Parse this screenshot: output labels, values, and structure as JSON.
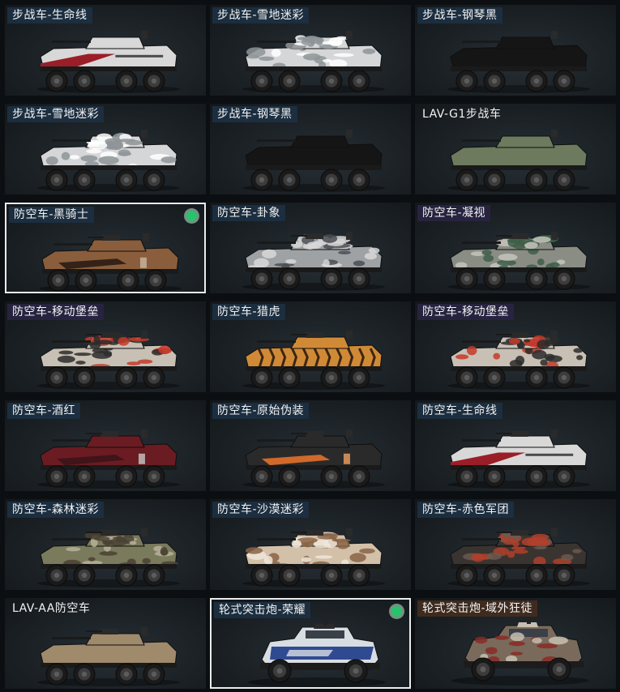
{
  "skins": [
    {
      "label": "步战车-生命线",
      "tag": "blue",
      "vehicle": "ifv",
      "pattern": "lifeline",
      "equipped": false,
      "colors": {
        "base": "#d8d8d8",
        "accent": "#9a1e28",
        "dark": "#4a4a4a"
      }
    },
    {
      "label": "步战车-雪地迷彩",
      "tag": "blue",
      "vehicle": "ifv",
      "pattern": "camo",
      "equipped": false,
      "colors": {
        "base": "#d4d6d8",
        "accent": "#8e9498",
        "dark": "#ffffff"
      }
    },
    {
      "label": "步战车-钢琴黑",
      "tag": "blue",
      "vehicle": "ifv",
      "pattern": "solid",
      "equipped": false,
      "colors": {
        "base": "#151515",
        "accent": "#2a2a2a",
        "dark": "#b8a060"
      }
    },
    {
      "label": "步战车-雪地迷彩",
      "tag": "blue",
      "vehicle": "ifv",
      "pattern": "camo",
      "equipped": false,
      "colors": {
        "base": "#d4d6d8",
        "accent": "#8e9498",
        "dark": "#ffffff"
      }
    },
    {
      "label": "步战车-钢琴黑",
      "tag": "blue",
      "vehicle": "ifv",
      "pattern": "solid",
      "equipped": false,
      "colors": {
        "base": "#151515",
        "accent": "#2a2a2a",
        "dark": "#b8a060"
      }
    },
    {
      "label": "LAV-G1步战车",
      "tag": "plain",
      "vehicle": "ifv",
      "pattern": "solid",
      "equipped": false,
      "colors": {
        "base": "#6d7a5d",
        "accent": "#5a664c",
        "dark": "#3b4433"
      }
    },
    {
      "label": "防空车-黑骑士",
      "tag": "blue",
      "vehicle": "aa",
      "pattern": "stripe",
      "equipped": true,
      "colors": {
        "base": "#8a5e3c",
        "accent": "#2a1c14",
        "dark": "#c8b8a0"
      }
    },
    {
      "label": "防空车-卦象",
      "tag": "blue",
      "vehicle": "aa",
      "pattern": "camo",
      "equipped": false,
      "colors": {
        "base": "#9ea2a4",
        "accent": "#d8d8d8",
        "dark": "#4a4e52"
      }
    },
    {
      "label": "防空车-凝视",
      "tag": "purple",
      "vehicle": "aa",
      "pattern": "camo",
      "equipped": false,
      "colors": {
        "base": "#8a8d84",
        "accent": "#3e5e48",
        "dark": "#c4c4bc"
      }
    },
    {
      "label": "防空车-移动堡垒",
      "tag": "purple",
      "vehicle": "aa",
      "pattern": "camo",
      "equipped": false,
      "colors": {
        "base": "#c8c0b4",
        "accent": "#2c2c2c",
        "dark": "#c63a2a"
      }
    },
    {
      "label": "防空车-猎虎",
      "tag": "blue",
      "vehicle": "aa",
      "pattern": "tiger",
      "equipped": false,
      "colors": {
        "base": "#d08a36",
        "accent": "#2a1a10",
        "dark": "#e6a850"
      }
    },
    {
      "label": "防空车-移动堡垒",
      "tag": "purple",
      "vehicle": "aa",
      "pattern": "camo",
      "equipped": false,
      "colors": {
        "base": "#c8c0b4",
        "accent": "#2c2c2c",
        "dark": "#c63a2a"
      }
    },
    {
      "label": "防空车-酒红",
      "tag": "blue",
      "vehicle": "aa",
      "pattern": "stripe",
      "equipped": false,
      "colors": {
        "base": "#6a1c22",
        "accent": "#3c1418",
        "dark": "#c8c8c8"
      }
    },
    {
      "label": "防空车-原始伪装",
      "tag": "blue",
      "vehicle": "aa",
      "pattern": "stripe",
      "equipped": false,
      "colors": {
        "base": "#2a2a2a",
        "accent": "#e2702a",
        "dark": "#f0a060"
      }
    },
    {
      "label": "防空车-生命线",
      "tag": "blue",
      "vehicle": "aa",
      "pattern": "lifeline",
      "equipped": false,
      "colors": {
        "base": "#d8d8d8",
        "accent": "#9a1e28",
        "dark": "#4a4a4a"
      }
    },
    {
      "label": "防空车-森林迷彩",
      "tag": "blue",
      "vehicle": "aa",
      "pattern": "camo",
      "equipped": false,
      "colors": {
        "base": "#7a7a5c",
        "accent": "#4a4232",
        "dark": "#b8b09a"
      }
    },
    {
      "label": "防空车-沙漠迷彩",
      "tag": "blue",
      "vehicle": "aa",
      "pattern": "camo",
      "equipped": false,
      "colors": {
        "base": "#d2c0a8",
        "accent": "#8a6448",
        "dark": "#f0e6da"
      }
    },
    {
      "label": "防空车-赤色军团",
      "tag": "blue",
      "vehicle": "aa",
      "pattern": "camo",
      "equipped": false,
      "colors": {
        "base": "#3a3430",
        "accent": "#b0402c",
        "dark": "#6a5a50"
      }
    },
    {
      "label": "LAV-AA防空车",
      "tag": "plain",
      "vehicle": "aa",
      "pattern": "solid",
      "equipped": false,
      "colors": {
        "base": "#a08a6c",
        "accent": "#7c6a52",
        "dark": "#c4b294"
      }
    },
    {
      "label": "轮式突击炮-荣耀",
      "tag": "blue",
      "vehicle": "assault",
      "pattern": "stripe",
      "equipped": true,
      "colors": {
        "base": "#d8dde2",
        "accent": "#1e3a8a",
        "dark": "#2a2a2a"
      }
    },
    {
      "label": "轮式突击炮-域外狂徒",
      "tag": "brown",
      "vehicle": "assault",
      "pattern": "camo",
      "equipped": false,
      "colors": {
        "base": "#7a6a5c",
        "accent": "#8a2a24",
        "dark": "#c8bfb0"
      }
    }
  ]
}
